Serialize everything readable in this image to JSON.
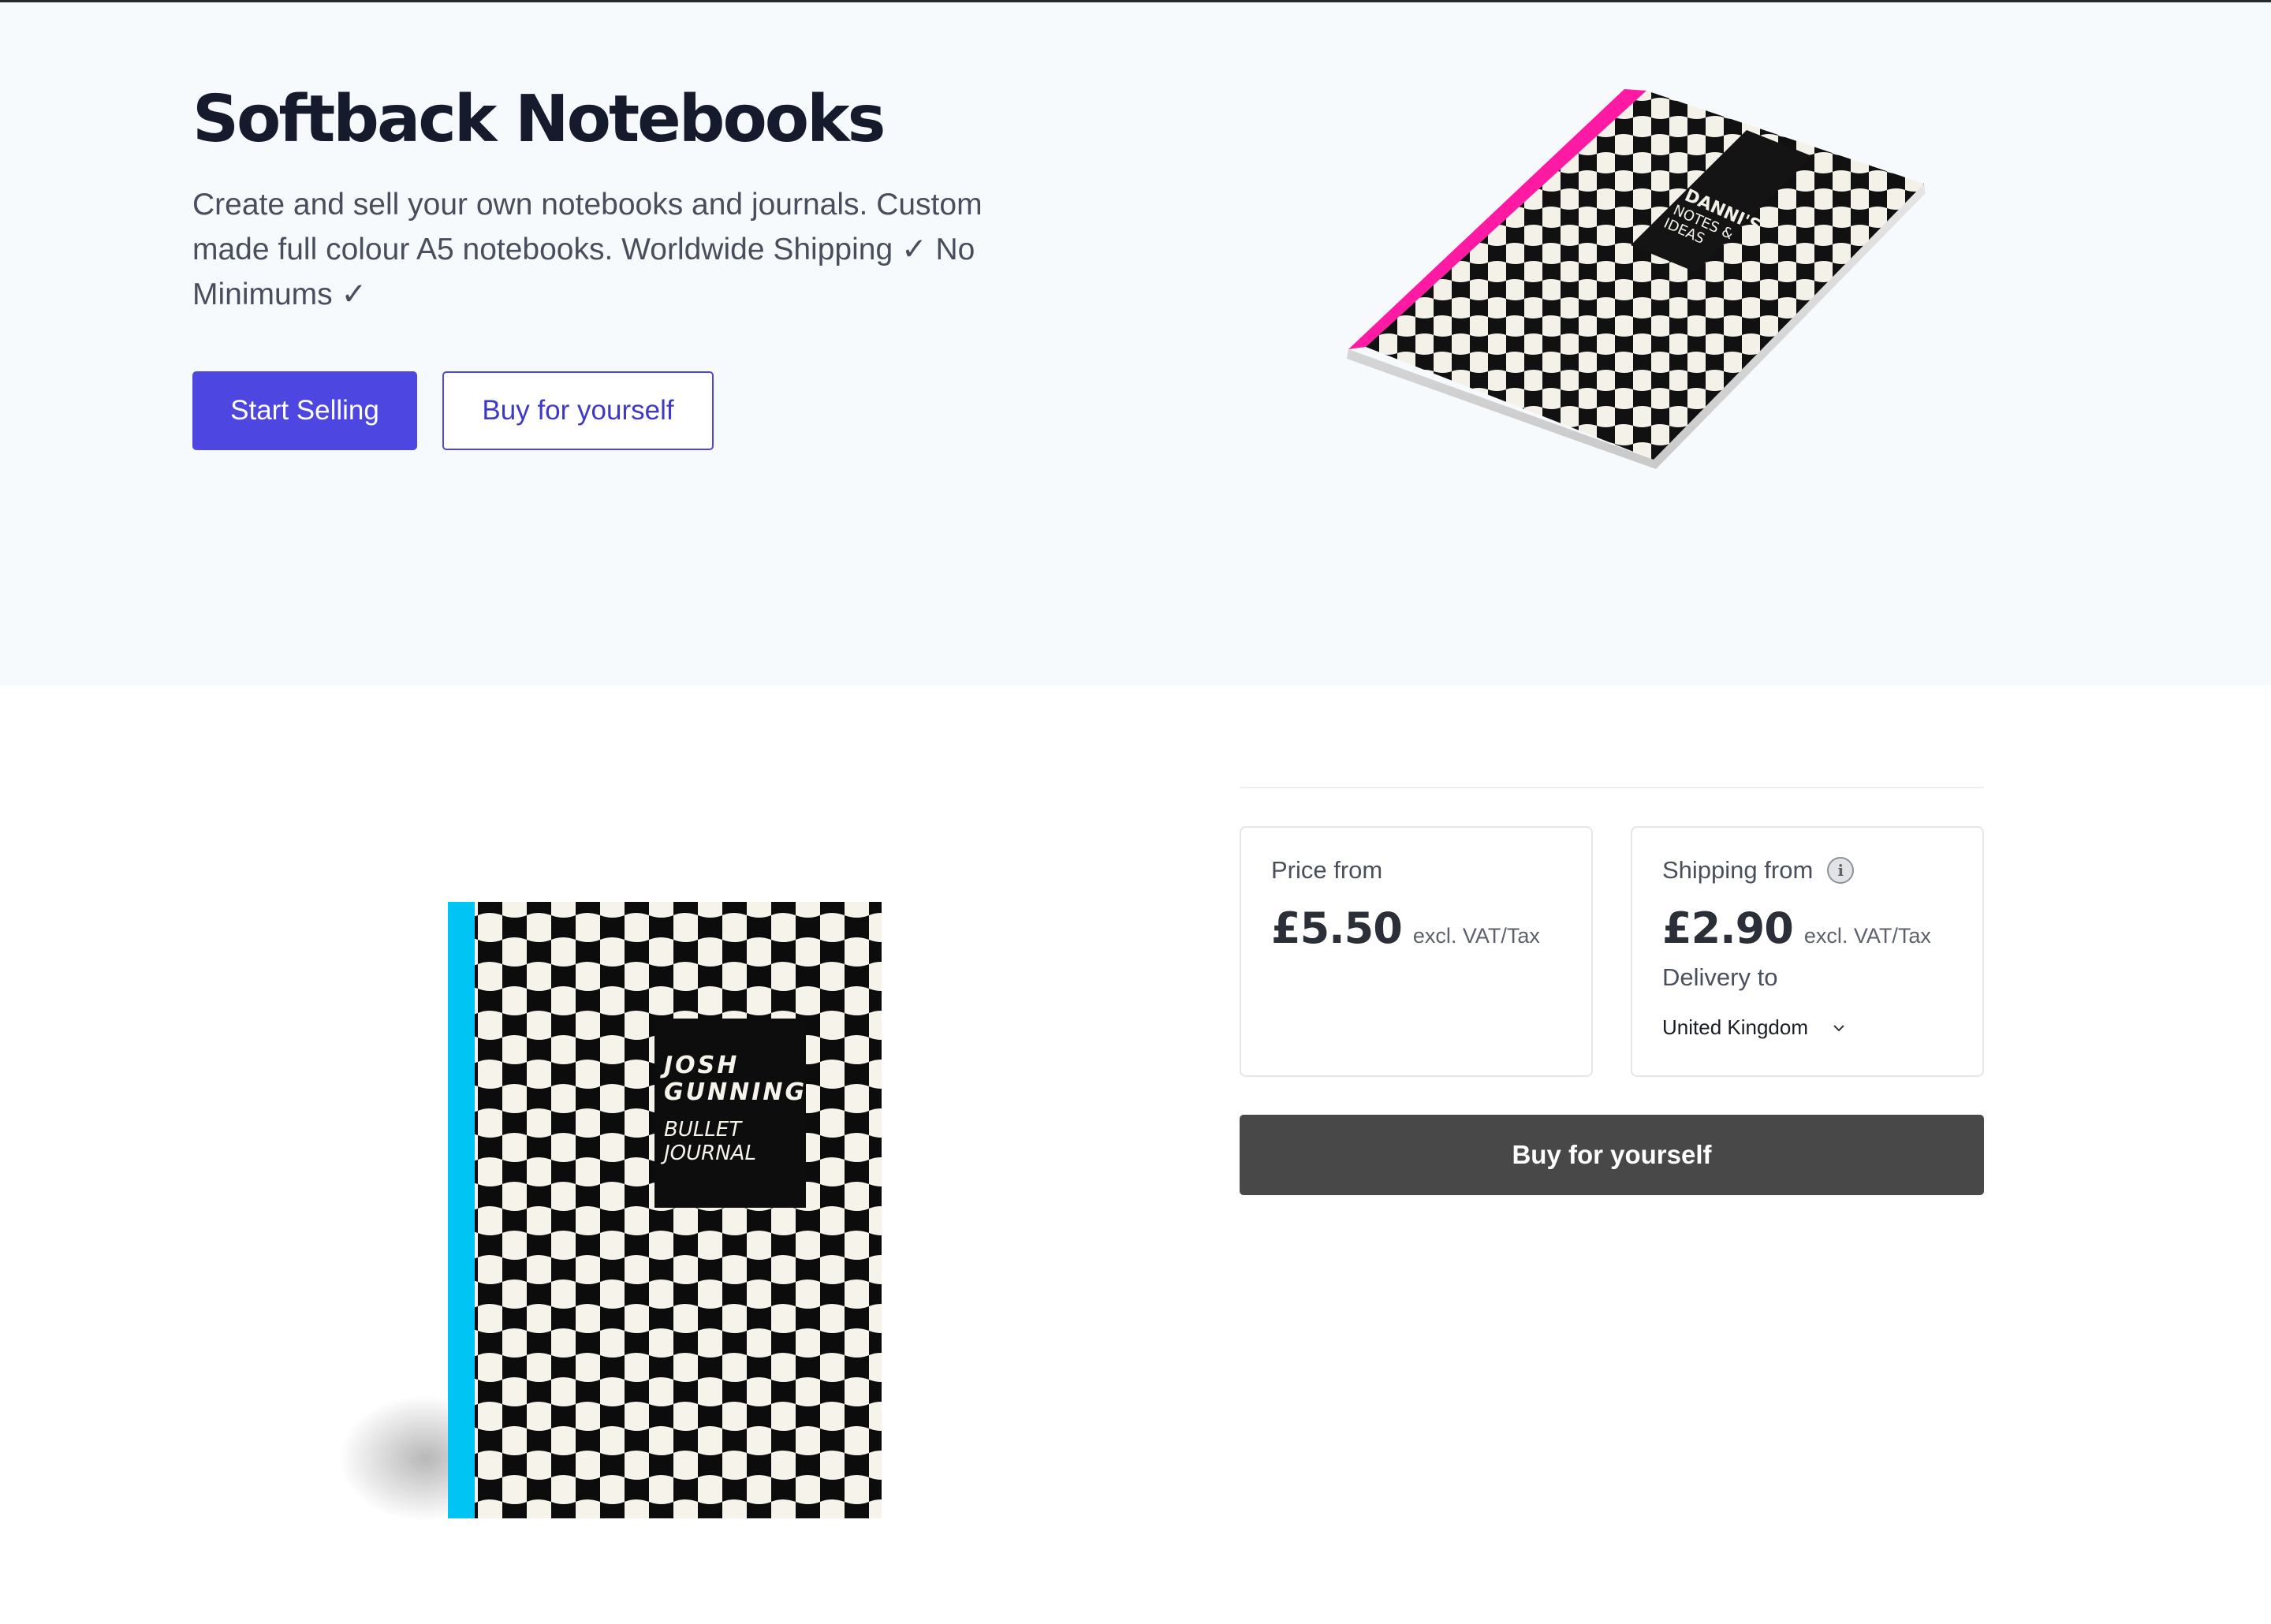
{
  "hero": {
    "title": "Softback Notebooks",
    "description": "Create and sell your own notebooks and journals. Custom made full colour A5 notebooks. Worldwide Shipping ✓ No Minimums ✓",
    "start_selling_label": "Start Selling",
    "buy_for_yourself_label": "Buy for yourself",
    "notebook_image": {
      "cover_text_line1": "DANNI'S",
      "cover_text_line2": "NOTES &",
      "cover_text_line3": "IDEAS",
      "spine_color": "#ff1aa3"
    }
  },
  "product": {
    "notebook_image": {
      "cover_text_line1": "JOSH",
      "cover_text_line2": "GUNNING",
      "cover_text_line3": "BULLET",
      "cover_text_line4": "JOURNAL",
      "spine_color": "#00c4f4"
    },
    "price_card": {
      "label": "Price from",
      "amount": "£5.50",
      "note": "excl. VAT/Tax"
    },
    "shipping_card": {
      "label": "Shipping from",
      "info_icon": "info-icon",
      "amount": "£2.90",
      "note": "excl. VAT/Tax",
      "delivery_label": "Delivery to",
      "country": "United Kingdom",
      "dropdown_icon": "chevron-down-icon"
    },
    "buy_button_label": "Buy for yourself"
  },
  "colors": {
    "primary": "#4d46e0",
    "hero_bg": "#f7fafd",
    "dark_button": "#484848",
    "title": "#151a2d"
  }
}
